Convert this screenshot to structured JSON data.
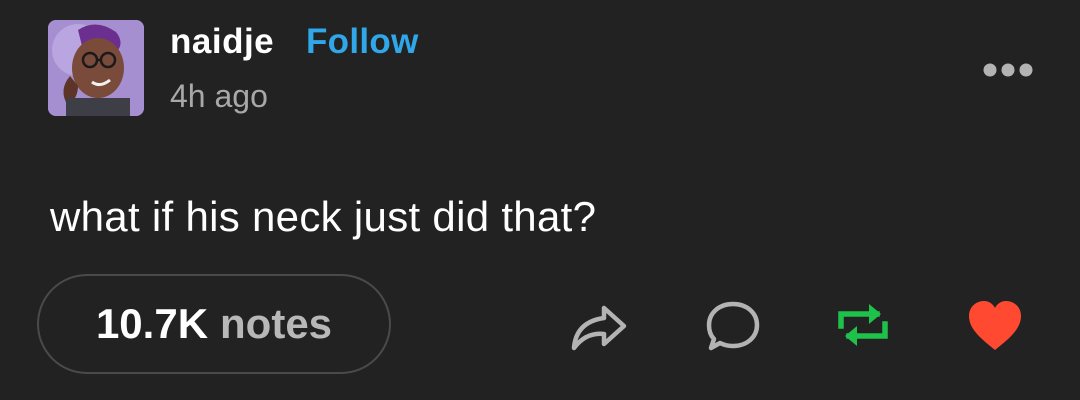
{
  "post": {
    "author": "naidje",
    "follow_label": "Follow",
    "timestamp": "4h ago",
    "body": "what if his neck just did that?"
  },
  "footer": {
    "notes_count": "10.7K",
    "notes_label": "notes"
  },
  "icons": {
    "more": "more-options-icon",
    "share": "share-icon",
    "reply": "reply-icon",
    "reblog": "reblog-icon",
    "like": "heart-icon"
  },
  "colors": {
    "background": "#222222",
    "follow": "#2fa7e8",
    "reblog": "#1ec14a",
    "like": "#ff4930",
    "muted": "#a8a8a8"
  }
}
